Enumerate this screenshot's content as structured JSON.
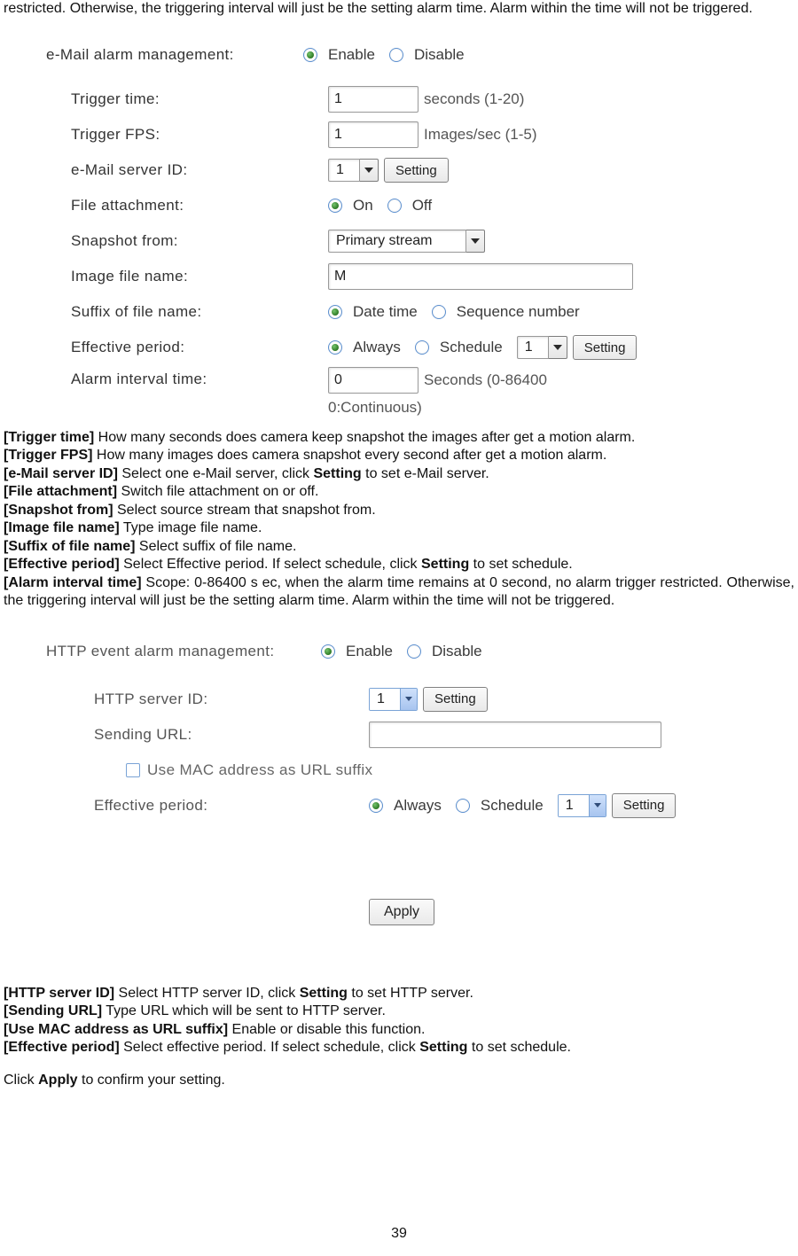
{
  "top_paragraph": "restricted. Otherwise, the triggering interval will just be the setting alarm time. Alarm within the time will not be triggered.",
  "panel1": {
    "header_label": "e-Mail alarm management:",
    "radio_enable": "Enable",
    "radio_disable": "Disable",
    "trigger_time_label": "Trigger time:",
    "trigger_time_value": "1",
    "trigger_time_hint": "seconds (1-20)",
    "trigger_fps_label": "Trigger FPS:",
    "trigger_fps_value": "1",
    "trigger_fps_hint": "Images/sec (1-5)",
    "mail_id_label": "e-Mail server ID:",
    "mail_id_value": "1",
    "setting_btn": "Setting",
    "file_attach_label": "File attachment:",
    "radio_on": "On",
    "radio_off": "Off",
    "snapshot_from_label": "Snapshot from:",
    "snapshot_from_value": "Primary stream",
    "image_name_label": "Image file name:",
    "image_name_value": "M",
    "suffix_label": "Suffix of file name:",
    "suffix_date": "Date time",
    "suffix_seq": "Sequence number",
    "effective_label": "Effective period:",
    "eff_always": "Always",
    "eff_schedule": "Schedule",
    "eff_sched_value": "1",
    "alarm_interval_label": "Alarm interval time:",
    "alarm_interval_value": "0",
    "alarm_interval_hint1": "Seconds (0-86400",
    "alarm_interval_hint2": "0:Continuous)"
  },
  "desc1": [
    {
      "key": "[Trigger time]",
      "text": " How many seconds does camera keep snapshot the images after get a motion alarm."
    },
    {
      "key": "[Trigger FPS]",
      "text": " How many images does camera snapshot every second after get a motion alarm."
    },
    {
      "key": "[e-Mail server ID]",
      "text": " Select one e-Mail server, click ",
      "bold": "Setting",
      "after": " to set e-Mail server."
    },
    {
      "key": "[File attachment]",
      "text": " Switch file attachment on or off."
    },
    {
      "key": "[Snapshot from]",
      "text": " Select source stream that snapshot from."
    },
    {
      "key": "[Image file name]",
      "text": " Type image file name."
    },
    {
      "key": "[Suffix of file name]",
      "text": " Select suffix of file name."
    },
    {
      "key": "[Effective period]",
      "text": " Select Effective period. If select schedule, click ",
      "bold": "Setting",
      "after": " to set schedule."
    },
    {
      "key": "[Alarm interval time]",
      "text": " Scope: 0-86400 s ec, when the alarm time remains at 0 second, no alarm trigger restricted. Otherwise, the triggering interval will just be the setting alarm time. Alarm within the time will not be triggered.",
      "justified": true
    }
  ],
  "panel2": {
    "header_label": "HTTP event alarm management:",
    "radio_enable": "Enable",
    "radio_disable": "Disable",
    "http_id_label": "HTTP server ID:",
    "http_id_value": "1",
    "setting_btn": "Setting",
    "sending_url_label": "Sending URL:",
    "sending_url_value": "",
    "use_mac_label": "Use MAC address as URL suffix",
    "effective_label": "Effective period:",
    "eff_always": "Always",
    "eff_schedule": "Schedule",
    "eff_sched_value": "1",
    "apply_btn": "Apply"
  },
  "desc2": [
    {
      "key": "[HTTP server ID]",
      "text": " Select HTTP server ID, click ",
      "bold": "Setting",
      "after": " to set HTTP server."
    },
    {
      "key": "[Sending URL]",
      "text": " Type URL which will be sent to HTTP server."
    },
    {
      "key": "[Use MAC address as URL suffix]",
      "text": " Enable or disable this function."
    },
    {
      "key": "[Effective period]",
      "text": " Select effective period. If select schedule, click ",
      "bold": "Setting",
      "after": " to set schedule."
    }
  ],
  "closing_line_pre": "Click ",
  "closing_line_bold": "Apply",
  "closing_line_post": " to confirm your setting.",
  "page_number": "39"
}
